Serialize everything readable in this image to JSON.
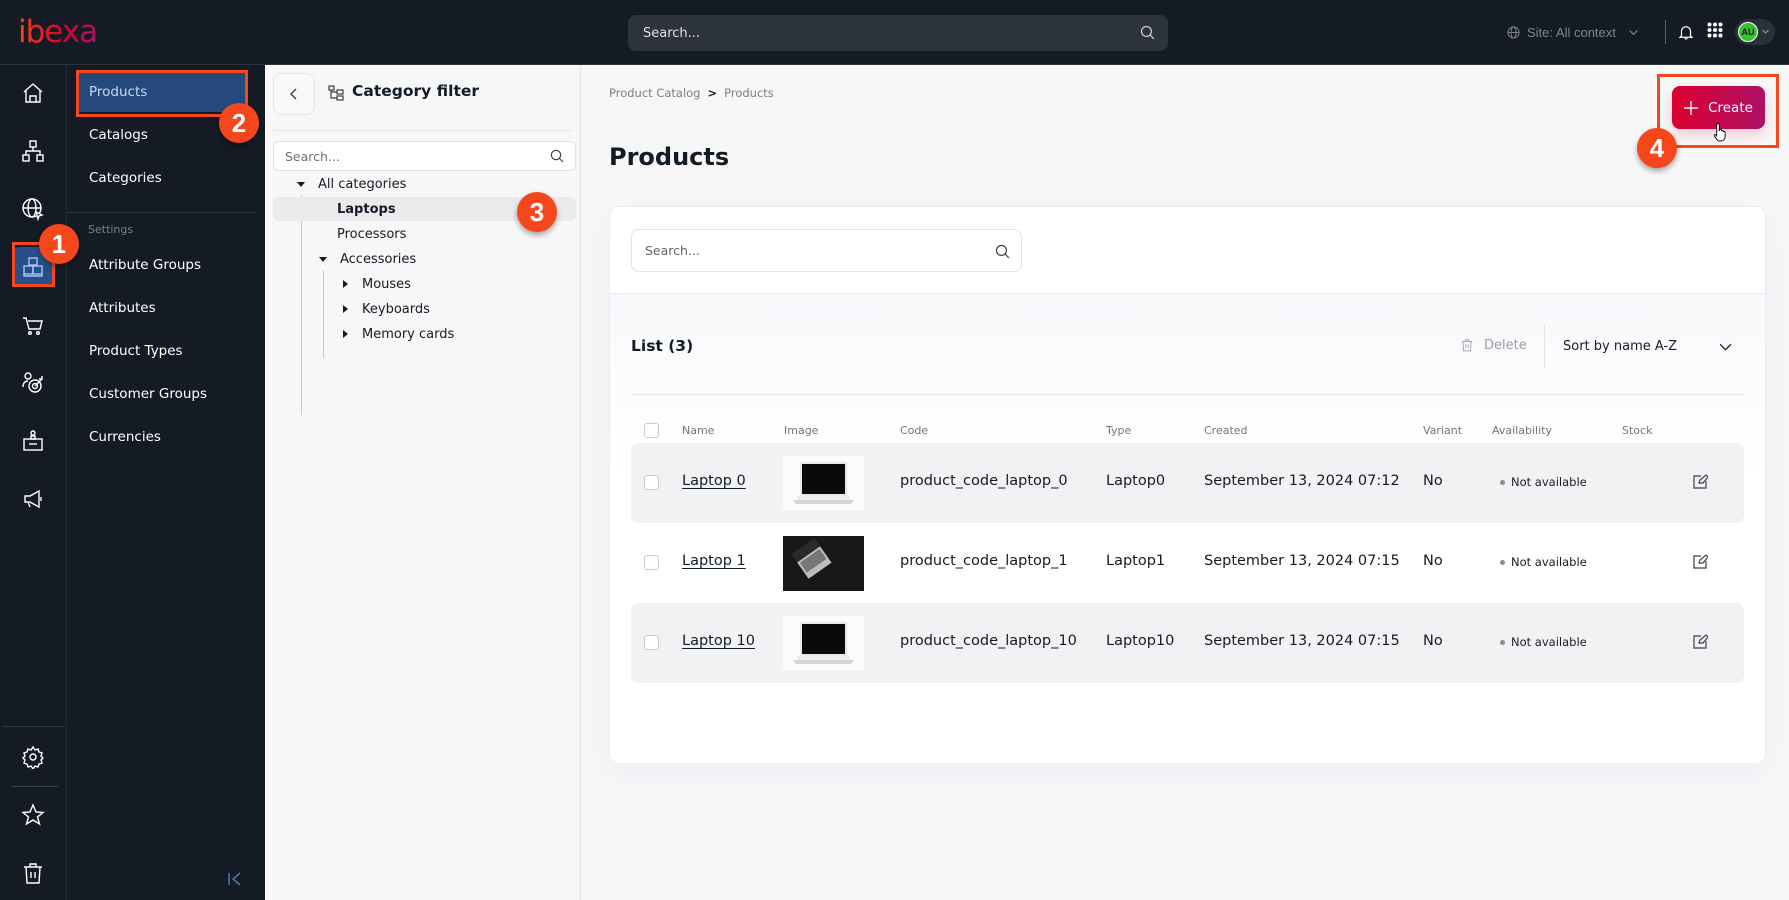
{
  "app": {
    "logo": "ibexa"
  },
  "topbar": {
    "search_placeholder": "Search...",
    "site_context": "Site: All context",
    "user_initials": "AU"
  },
  "rail": {
    "items": [
      {
        "icon": "home-icon"
      },
      {
        "icon": "content-tree-icon"
      },
      {
        "icon": "globe-icon"
      },
      {
        "icon": "product-catalog-icon",
        "active": true
      },
      {
        "icon": "cart-icon"
      },
      {
        "icon": "customer-target-icon"
      },
      {
        "icon": "id-badge-icon"
      },
      {
        "icon": "megaphone-icon"
      }
    ],
    "bottom": [
      {
        "icon": "gear-icon"
      },
      {
        "icon": "star-icon"
      },
      {
        "icon": "trash-icon"
      }
    ]
  },
  "subnav": {
    "items": [
      "Products",
      "Catalogs",
      "Categories"
    ],
    "settings_label": "Settings",
    "settings_items": [
      "Attribute Groups",
      "Attributes",
      "Product Types",
      "Customer Groups",
      "Currencies"
    ]
  },
  "category_filter": {
    "title": "Category filter",
    "search_placeholder": "Search...",
    "tree": {
      "root": "All categories",
      "children": [
        "Laptops",
        "Processors",
        "Accessories"
      ],
      "accessories_children": [
        "Mouses",
        "Keyboards",
        "Memory cards"
      ],
      "selected": "Laptops"
    }
  },
  "main": {
    "breadcrumb": [
      "Product Catalog",
      "Products"
    ],
    "breadcrumb_separator": ">",
    "title": "Products",
    "create_label": "Create",
    "search_placeholder": "Search...",
    "list_title": "List (3)",
    "delete_label": "Delete",
    "sort_label": "Sort by name A-Z",
    "columns": [
      "Name",
      "Image",
      "Code",
      "Type",
      "Created",
      "Variant",
      "Availability",
      "Stock"
    ],
    "rows": [
      {
        "name": "Laptop 0",
        "image": "light",
        "code": "product_code_laptop_0",
        "type": "Laptop0",
        "created": "September 13, 2024 07:12",
        "variant": "No",
        "availability": "Not available",
        "stock": ""
      },
      {
        "name": "Laptop 1",
        "image": "dark",
        "code": "product_code_laptop_1",
        "type": "Laptop1",
        "created": "September 13, 2024 07:15",
        "variant": "No",
        "availability": "Not available",
        "stock": ""
      },
      {
        "name": "Laptop 10",
        "image": "light",
        "code": "product_code_laptop_10",
        "type": "Laptop10",
        "created": "September 13, 2024 07:15",
        "variant": "No",
        "availability": "Not available",
        "stock": ""
      }
    ]
  },
  "annotations": [
    "1",
    "2",
    "3",
    "4"
  ],
  "colors": {
    "accent": "#db0032",
    "annotation": "#f5471b",
    "nav_bg": "#151b24",
    "nav_active": "#25497a"
  }
}
